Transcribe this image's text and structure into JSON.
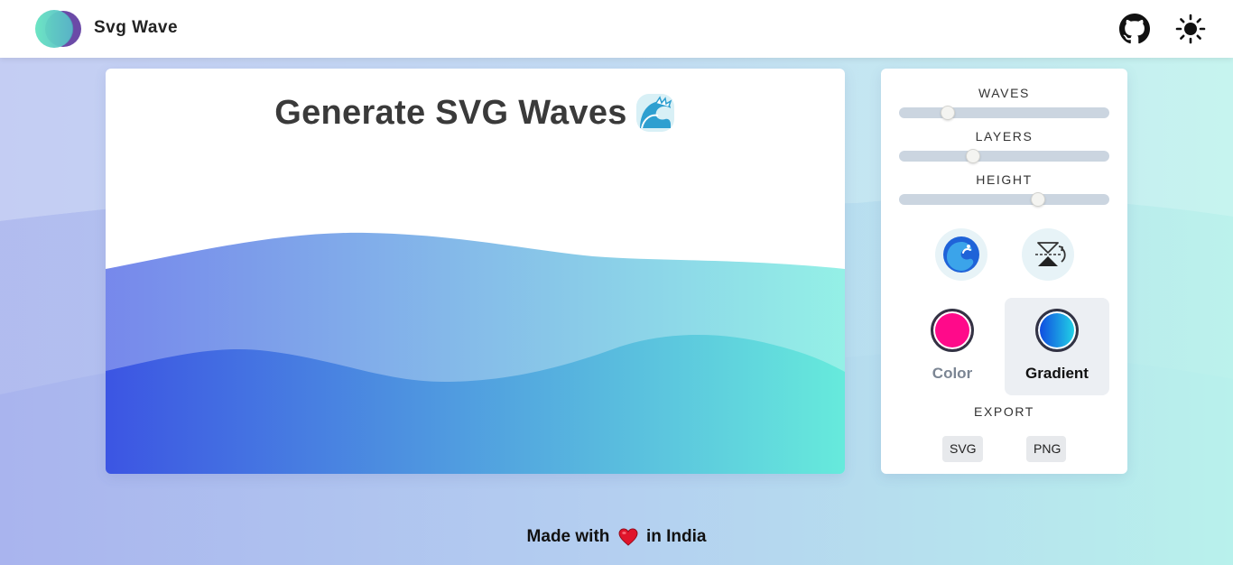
{
  "navbar": {
    "brand": "Svg Wave",
    "github_icon": "github-icon",
    "theme_icon": "sun-icon"
  },
  "preview": {
    "title": "Generate SVG Waves",
    "title_emoji": "wave-emoji",
    "gradient_start": "#3c55e3",
    "gradient_end": "#66eadc"
  },
  "controls": {
    "waves_label": "WAVES",
    "layers_label": "LAYERS",
    "height_label": "HEIGHT",
    "waves_value": 0.23,
    "layers_value": 0.35,
    "height_value": 0.66,
    "randomize_icon": "wave-randomize-icon",
    "flip_icon": "flip-icon",
    "modes": [
      {
        "label": "Color",
        "swatch": "#ff0a8a",
        "selected": false
      },
      {
        "label": "Gradient",
        "swatch_start": "#0f47e0",
        "swatch_end": "#22d7e6",
        "selected": true
      }
    ],
    "export_label": "EXPORT",
    "export_svg": "SVG",
    "export_png": "PNG"
  },
  "footer": {
    "prefix": "Made with",
    "heart_icon": "heart-icon",
    "suffix": "in India"
  }
}
